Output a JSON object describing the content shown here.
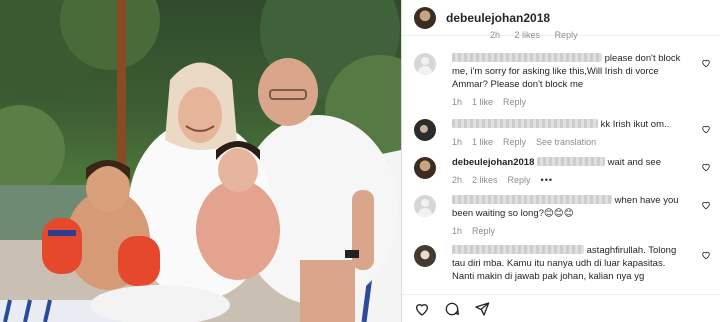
{
  "post": {
    "username": "debeulejohan2018",
    "photo_description_icon": "family-photo"
  },
  "previous_comment_meta": {
    "time": "2h",
    "likes": "2 likes",
    "reply": "Reply"
  },
  "comments": [
    {
      "username_hidden": true,
      "text_a": "please don't block",
      "text_b": "me, i'm sorry for asking like this,Will Irish di vorce",
      "text_c": "Ammar? Please don't block me",
      "time": "1h",
      "likes": "1 like",
      "reply": "Reply",
      "avatar": "default-avatar"
    },
    {
      "username_hidden": true,
      "text": "kk Irish ikut om..",
      "time": "1h",
      "likes": "1 like",
      "reply": "Reply",
      "translation": "See translation",
      "avatar": "dark-avatar"
    },
    {
      "username": "debeulejohan2018",
      "text": "wait and see",
      "time": "2h",
      "likes": "2 likes",
      "reply": "Reply",
      "more": "•••",
      "avatar": "owner-avatar"
    },
    {
      "username_hidden": true,
      "text_a": "when have you",
      "text_b": "been waiting so long?😊😊😊",
      "time": "1h",
      "reply": "Reply",
      "avatar": "default-avatar"
    },
    {
      "username_hidden": true,
      "text_a": "astaghfirullah. Tolong",
      "text_b": "tau diri mba. Kamu itu nanya udh di luar kapasitas.",
      "text_c": "Nanti makin di jawab pak johan, kalian nya yg",
      "avatar": "light-avatar"
    }
  ],
  "colors": {
    "text": "#262626",
    "muted": "#8e8e8e",
    "border": "#dbdbdb"
  }
}
